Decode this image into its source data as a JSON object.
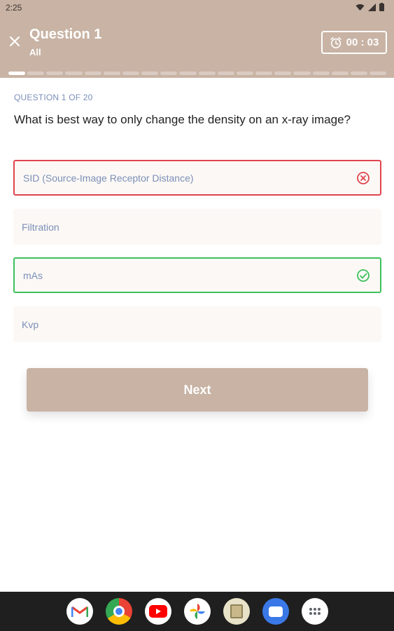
{
  "status_bar": {
    "time": "2:25"
  },
  "header": {
    "title": "Question 1",
    "subtitle": "All",
    "timer": "00 : 03",
    "progress_total": 20,
    "progress_current": 1
  },
  "quiz": {
    "counter": "QUESTION 1 OF 20",
    "question": "What is best way to only change the density on an x-ray image?",
    "options": [
      {
        "label": "SID (Source-Image Receptor Distance)",
        "state": "wrong"
      },
      {
        "label": "Filtration",
        "state": "none"
      },
      {
        "label": "mAs",
        "state": "correct"
      },
      {
        "label": "Kvp",
        "state": "none"
      }
    ],
    "next_label": "Next"
  },
  "dock": [
    "gmail-icon",
    "chrome-icon",
    "youtube-icon",
    "photos-icon",
    "files-icon",
    "messages-icon",
    "app-drawer-icon"
  ],
  "colors": {
    "brand": "#c8b3a4",
    "wrong": "#e0444e",
    "correct": "#3cc15c",
    "option_text": "#7b8fb8"
  }
}
